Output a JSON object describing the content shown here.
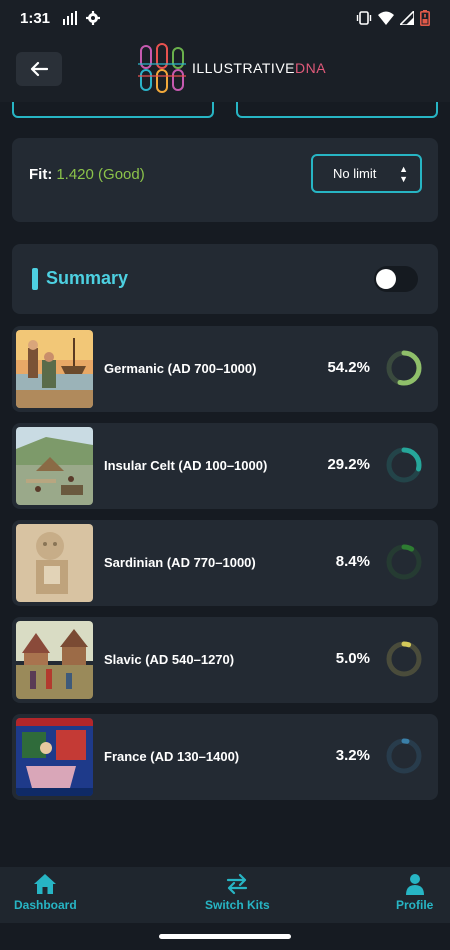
{
  "status_bar": {
    "time": "1:31"
  },
  "app": {
    "logo_main": "ILLUSTRATIVE",
    "logo_accent": "DNA"
  },
  "fit": {
    "label": "Fit:",
    "value": "1.420 (Good)",
    "limit_option": "No limit"
  },
  "summary": {
    "title": "Summary",
    "toggle_on": false
  },
  "populations": [
    {
      "name": "Germanic (AD 700–1000)",
      "percent": "54.2%",
      "value": 54.2,
      "color": "#8fbf6a"
    },
    {
      "name": "Insular Celt (AD 100–1000)",
      "percent": "29.2%",
      "value": 29.2,
      "color": "#26a69a"
    },
    {
      "name": "Sardinian (AD 770–1000)",
      "percent": "8.4%",
      "value": 8.4,
      "color": "#2e7d32"
    },
    {
      "name": "Slavic (AD 540–1270)",
      "percent": "5.0%",
      "value": 5.0,
      "color": "#d4c95a"
    },
    {
      "name": "France (AD 130–1400)",
      "percent": "3.2%",
      "value": 3.2,
      "color": "#3a7fa8"
    }
  ],
  "nav": {
    "dashboard": "Dashboard",
    "switch_kits": "Switch Kits",
    "profile": "Profile"
  },
  "colors": {
    "accent": "#27b5c4",
    "fit_good": "#8bc34a",
    "card": "#232a33",
    "background": "#161b22"
  }
}
